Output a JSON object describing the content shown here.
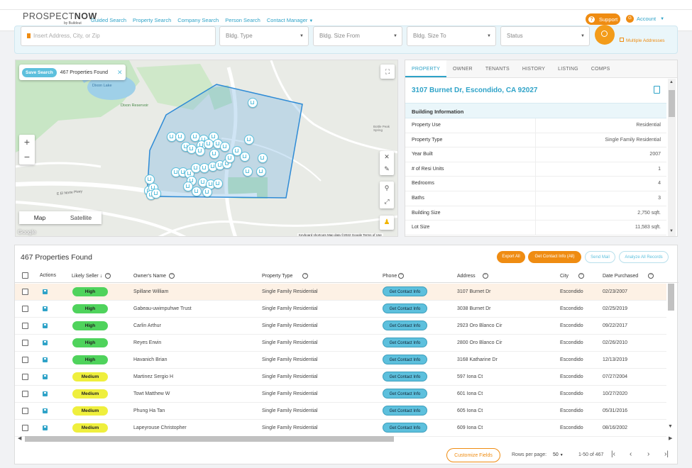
{
  "nav": {
    "logo_text": "PROSPECT",
    "logo_bold": "NOW",
    "logo_sub": "by Buildout",
    "links": [
      "Guided Search",
      "Property Search",
      "Company Search",
      "Person Search",
      "Contact Manager"
    ],
    "support": "Support",
    "account": "Account",
    "account_initial": "G"
  },
  "search": {
    "address_placeholder": "Insert Address, City, or Zip",
    "bldg_type": "Bldg. Type",
    "size_from": "Bldg. Size From",
    "size_to": "Bldg. Size To",
    "status": "Status",
    "multiple": "Multiple Addresses"
  },
  "map": {
    "save_search": "Save Search",
    "count_label": "467 Properties Found",
    "map_label": "Map",
    "satellite_label": "Satellite",
    "google": "Google",
    "footer": "Keyboard shortcuts   Map data ©2022 Google   Terms of Use",
    "place_lake": "Dixon Lake",
    "place_res": "Dixon Reservoir",
    "road": "E El Norte Pkwy",
    "place_right": "Bottle Peak Spring"
  },
  "detail": {
    "tabs": [
      "PROPERTY",
      "OWNER",
      "TENANTS",
      "HISTORY",
      "LISTING",
      "COMPS"
    ],
    "address": "3107 Burnet Dr, Escondido, CA 92027",
    "section": "Building Information",
    "rows": [
      {
        "k": "Property Use",
        "v": "Residential"
      },
      {
        "k": "Property Type",
        "v": "Single Family Residential"
      },
      {
        "k": "Year Built",
        "v": "2007"
      },
      {
        "k": "# of Resi Units",
        "v": "1"
      },
      {
        "k": "Bedrooms",
        "v": "4"
      },
      {
        "k": "Baths",
        "v": "3"
      },
      {
        "k": "Building Size",
        "v": "2,750 sqft."
      },
      {
        "k": "Lot Size",
        "v": "11,583 sqft."
      }
    ]
  },
  "table": {
    "title": "467 Properties Found",
    "buttons": {
      "export": "Export All",
      "contact": "Get Contact Info (All)",
      "mail": "Send Mail",
      "analyze": "Analyze All Records"
    },
    "headers": {
      "actions": "Actions",
      "seller": "Likely Seller",
      "owner": "Owner's Name",
      "ptype": "Property Type",
      "phone": "Phone",
      "address": "Address",
      "city": "City",
      "date": "Date Purchased"
    },
    "get_contact": "Get Contact Info",
    "rows": [
      {
        "seller": "High",
        "owner": "Spillane William",
        "ptype": "Single Family Residential",
        "address": "3107 Burnet Dr",
        "city": "Escondido",
        "date": "02/23/2007"
      },
      {
        "seller": "High",
        "owner": "Gabeau-uwimpuhwe Trust",
        "ptype": "Single Family Residential",
        "address": "3038 Burnet Dr",
        "city": "Escondido",
        "date": "02/25/2019"
      },
      {
        "seller": "High",
        "owner": "Carlin Arthur",
        "ptype": "Single Family Residential",
        "address": "2923 Oro Blanco Cir",
        "city": "Escondido",
        "date": "09/22/2017"
      },
      {
        "seller": "High",
        "owner": "Reyes Erwin",
        "ptype": "Single Family Residential",
        "address": "2800 Oro Blanco Cir",
        "city": "Escondido",
        "date": "02/26/2010"
      },
      {
        "seller": "High",
        "owner": "Havanich Brian",
        "ptype": "Single Family Residential",
        "address": "3168 Katharine Dr",
        "city": "Escondido",
        "date": "12/13/2019"
      },
      {
        "seller": "Medium",
        "owner": "Martinez Sergio H",
        "ptype": "Single Family Residential",
        "address": "597 Iona Ct",
        "city": "Escondido",
        "date": "07/27/2004"
      },
      {
        "seller": "Medium",
        "owner": "Towt Matthew W",
        "ptype": "Single Family Residential",
        "address": "601 Iona Ct",
        "city": "Escondido",
        "date": "10/27/2020"
      },
      {
        "seller": "Medium",
        "owner": "Phung Ha Tan",
        "ptype": "Single Family Residential",
        "address": "605 Iona Ct",
        "city": "Escondido",
        "date": "05/31/2016"
      },
      {
        "seller": "Medium",
        "owner": "Lapeyrouse Christopher",
        "ptype": "Single Family Residential",
        "address": "609 Iona Ct",
        "city": "Escondido",
        "date": "08/16/2002"
      }
    ],
    "footer": {
      "customize": "Customize Fields",
      "rows_per_page": "Rows per page:",
      "rpp_value": "50",
      "range": "1-50 of 467"
    }
  },
  "colors": {
    "accent": "#2fa3c8",
    "orange": "#ef8c12",
    "high": "#4fd35c",
    "medium": "#efef3d"
  }
}
